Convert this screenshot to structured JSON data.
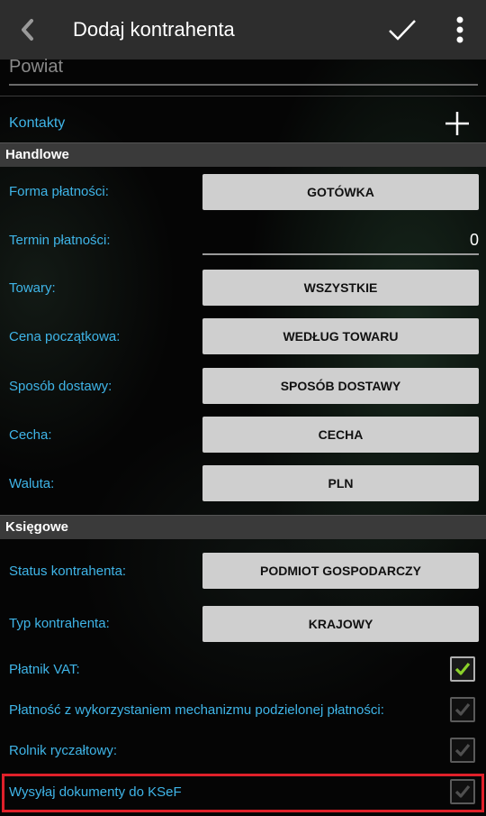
{
  "header": {
    "title": "Dodaj kontrahenta",
    "back_icon": "chevron-left-icon",
    "confirm_icon": "check-icon",
    "menu_icon": "more-vert-icon"
  },
  "address": {
    "powiat_placeholder": "Powiat"
  },
  "contacts": {
    "label": "Kontakty",
    "add_icon": "plus-icon"
  },
  "handlowe": {
    "title": "Handlowe",
    "forma_platnosci": {
      "label": "Forma płatności:",
      "value": "GOTÓWKA"
    },
    "termin_platnosci": {
      "label": "Termin płatności:",
      "value": "0"
    },
    "towary": {
      "label": "Towary:",
      "value": "WSZYSTKIE"
    },
    "cena": {
      "label": "Cena początkowa:",
      "value": "WEDŁUG TOWARU"
    },
    "dostawa": {
      "label": "Sposób dostawy:",
      "value": "SPOSÓB DOSTAWY"
    },
    "cecha": {
      "label": "Cecha:",
      "value": "CECHA"
    },
    "waluta": {
      "label": "Waluta:",
      "value": "PLN"
    }
  },
  "ksiegowe": {
    "title": "Księgowe",
    "status": {
      "label": "Status kontrahenta:",
      "value": "PODMIOT GOSPODARCZY"
    },
    "typ": {
      "label": "Typ kontrahenta:",
      "value": "KRAJOWY"
    },
    "platnik_vat": {
      "label": "Płatnik VAT:",
      "checked": true
    },
    "split_payment": {
      "label": "Płatność z wykorzystaniem mechanizmu podzielonej płatności:",
      "checked": true,
      "enabled": false
    },
    "rolnik": {
      "label": "Rolnik ryczałtowy:",
      "checked": true,
      "enabled": false
    },
    "ksef": {
      "label": "Wysyłaj dokumenty do KSeF",
      "checked": true,
      "enabled": false
    }
  },
  "colors": {
    "accent": "#3fb5e8",
    "check_green": "#8bd12a",
    "highlight": "#e0202a"
  }
}
